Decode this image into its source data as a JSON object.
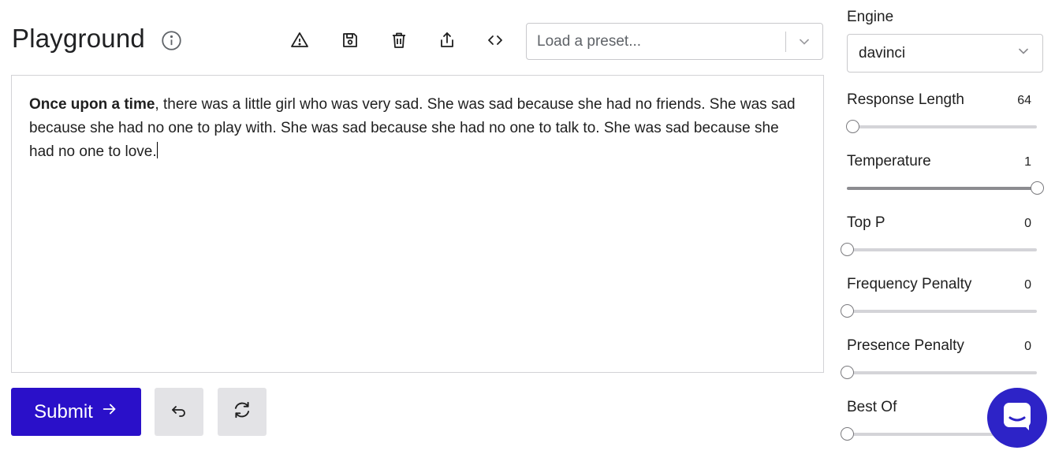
{
  "header": {
    "title": "Playground"
  },
  "preset": {
    "placeholder": "Load a preset..."
  },
  "editor": {
    "bold_text": "Once upon a time",
    "text": ", there was a little girl who was very sad. She was sad because she had no friends. She was sad because she had no one to play with. She was sad because she had no one to talk to. She was sad because she had no one to love."
  },
  "actions": {
    "submit_label": "Submit"
  },
  "settings": {
    "engine_label": "Engine",
    "engine_value": "davinci",
    "response_length": {
      "label": "Response Length",
      "value": "64",
      "level": 0.03
    },
    "temperature": {
      "label": "Temperature",
      "value": "1",
      "level": 1.0
    },
    "top_p": {
      "label": "Top P",
      "value": "0",
      "level": 0.0
    },
    "frequency_penalty": {
      "label": "Frequency Penalty",
      "value": "0",
      "level": 0.0
    },
    "presence_penalty": {
      "label": "Presence Penalty",
      "value": "0",
      "level": 0.0
    },
    "best_of": {
      "label": "Best Of",
      "level": 0.0
    }
  },
  "colors": {
    "accent": "#2a10c9",
    "chat_bubble": "#2d23c7"
  }
}
